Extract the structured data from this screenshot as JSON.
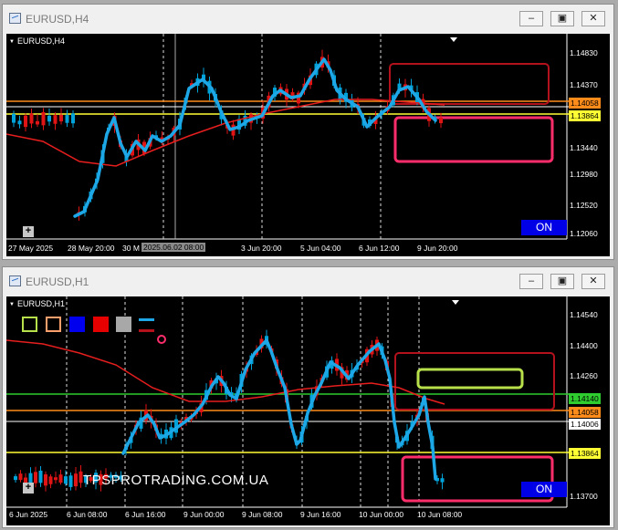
{
  "window_top": {
    "title": "EURUSD,H4",
    "symbol_label": "EURUSD,H4",
    "on_label": "ON",
    "crosshair_time": "2025.06.02 08:00",
    "price_levels": [
      "1.14830",
      "1.14370",
      "1.13900",
      "1.13440",
      "1.12980",
      "1.12520",
      "1.12060"
    ],
    "price_tags": [
      {
        "value": "1.14058",
        "color": "#ff8c1a"
      },
      {
        "value": "1.13864",
        "color": "#ffff33"
      }
    ],
    "time_labels": [
      "27 May 2025",
      "28 May 20:00",
      "30 M",
      "3 Jun 20:00",
      "5 Jun 04:00",
      "6 Jun 12:00",
      "9 Jun 20:00"
    ]
  },
  "window_bottom": {
    "title": "EURUSD,H1",
    "symbol_label": "EURUSD,H1",
    "on_label": "ON",
    "watermark": "TPSPROTRADING.COM.UA",
    "price_levels": [
      "1.14540",
      "1.14400",
      "1.14260",
      "1.14120",
      "1.13980",
      "1.13840",
      "1.13700"
    ],
    "price_tags": [
      {
        "value": "1.14140",
        "color": "#2ecc2e"
      },
      {
        "value": "1.14058",
        "color": "#ff8c1a"
      },
      {
        "value": "1.14006",
        "color": "#ffffff"
      },
      {
        "value": "1.13864",
        "color": "#ffff33"
      }
    ],
    "time_labels": [
      "6 Jun 2025",
      "6 Jun 08:00",
      "6 Jun 16:00",
      "9 Jun 00:00",
      "9 Jun 08:00",
      "9 Jun 16:00",
      "10 Jun 00:00",
      "10 Jun 08:00"
    ]
  },
  "colors": {
    "bull": "#00a3d9",
    "bear": "#e01414",
    "trend": "#1ea7e6",
    "ma": "#e61e1e",
    "zone_dark": "#b3121c",
    "zone_pink": "#ff2e6b",
    "zone_green": "#b8e04a"
  }
}
